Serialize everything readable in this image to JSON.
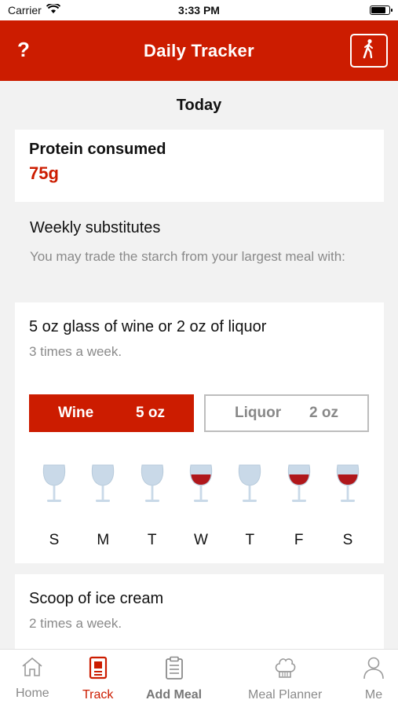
{
  "status_bar": {
    "carrier": "Carrier",
    "time": "3:33 PM"
  },
  "nav": {
    "help": "?",
    "title": "Daily Tracker"
  },
  "today": "Today",
  "protein": {
    "title": "Protein consumed",
    "value": "75g"
  },
  "weekly": {
    "title": "Weekly substitutes",
    "description": "You may trade the starch from your largest meal with:"
  },
  "wine_card": {
    "title": "5 oz glass of wine or 2 oz of liquor",
    "frequency": "3 times a week.",
    "options": [
      {
        "name": "Wine",
        "amount": "5 oz",
        "selected": true
      },
      {
        "name": "Liquor",
        "amount": "2 oz",
        "selected": false
      }
    ],
    "days": [
      {
        "label": "S",
        "filled": false
      },
      {
        "label": "M",
        "filled": false
      },
      {
        "label": "T",
        "filled": false
      },
      {
        "label": "W",
        "filled": true
      },
      {
        "label": "T",
        "filled": false
      },
      {
        "label": "F",
        "filled": true
      },
      {
        "label": "S",
        "filled": true
      }
    ]
  },
  "ice_card": {
    "title": "Scoop of ice cream",
    "frequency": "2 times a week."
  },
  "tabs": [
    {
      "label": "Home",
      "icon": "home-icon",
      "active": false
    },
    {
      "label": "Track",
      "icon": "track-icon",
      "active": true
    },
    {
      "label": "Add Meal",
      "icon": "clipboard-icon",
      "active": false
    },
    {
      "label": "Meal Planner",
      "icon": "chef-hat-icon",
      "active": false
    },
    {
      "label": "Me",
      "icon": "person-icon",
      "active": false
    }
  ],
  "colors": {
    "accent": "#cc1c00",
    "glass": "#c9d9e8",
    "wine": "#b0171b"
  }
}
